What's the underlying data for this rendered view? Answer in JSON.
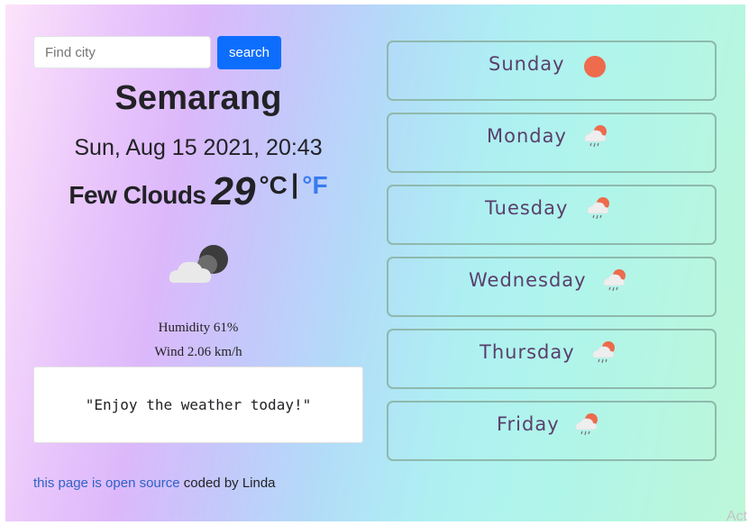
{
  "search": {
    "placeholder": "Find city",
    "button_label": "search"
  },
  "current": {
    "city": "Semarang",
    "datetime": "Sun, Aug 15 2021, 20:43",
    "condition": "Few Clouds",
    "temperature": "29",
    "unit_c": "°C",
    "separator": "|",
    "unit_f": "°F",
    "humidity": "Humidity 61%",
    "wind": "Wind 2.06 km/h",
    "icon": "cloud-moon-icon"
  },
  "quote": "\"Enjoy the weather today!\"",
  "footer": {
    "link_text": "this page is open source",
    "text": "coded by Linda"
  },
  "forecast": [
    {
      "day": "Sunday",
      "icon": "sun-icon"
    },
    {
      "day": "Monday",
      "icon": "rain-icon"
    },
    {
      "day": "Tuesday",
      "icon": "rain-icon"
    },
    {
      "day": "Wednesday",
      "icon": "rain-icon"
    },
    {
      "day": "Thursday",
      "icon": "rain-icon"
    },
    {
      "day": "Friday",
      "icon": "rain-icon"
    }
  ],
  "watermark": "Act",
  "colors": {
    "accent": "#0d6efd",
    "fahrenheit": "#3a7bf0",
    "link": "#2f62c7",
    "sun": "#ee6b4d",
    "day_label": "#5a3f6b",
    "day_border": "#8fb9ad"
  }
}
